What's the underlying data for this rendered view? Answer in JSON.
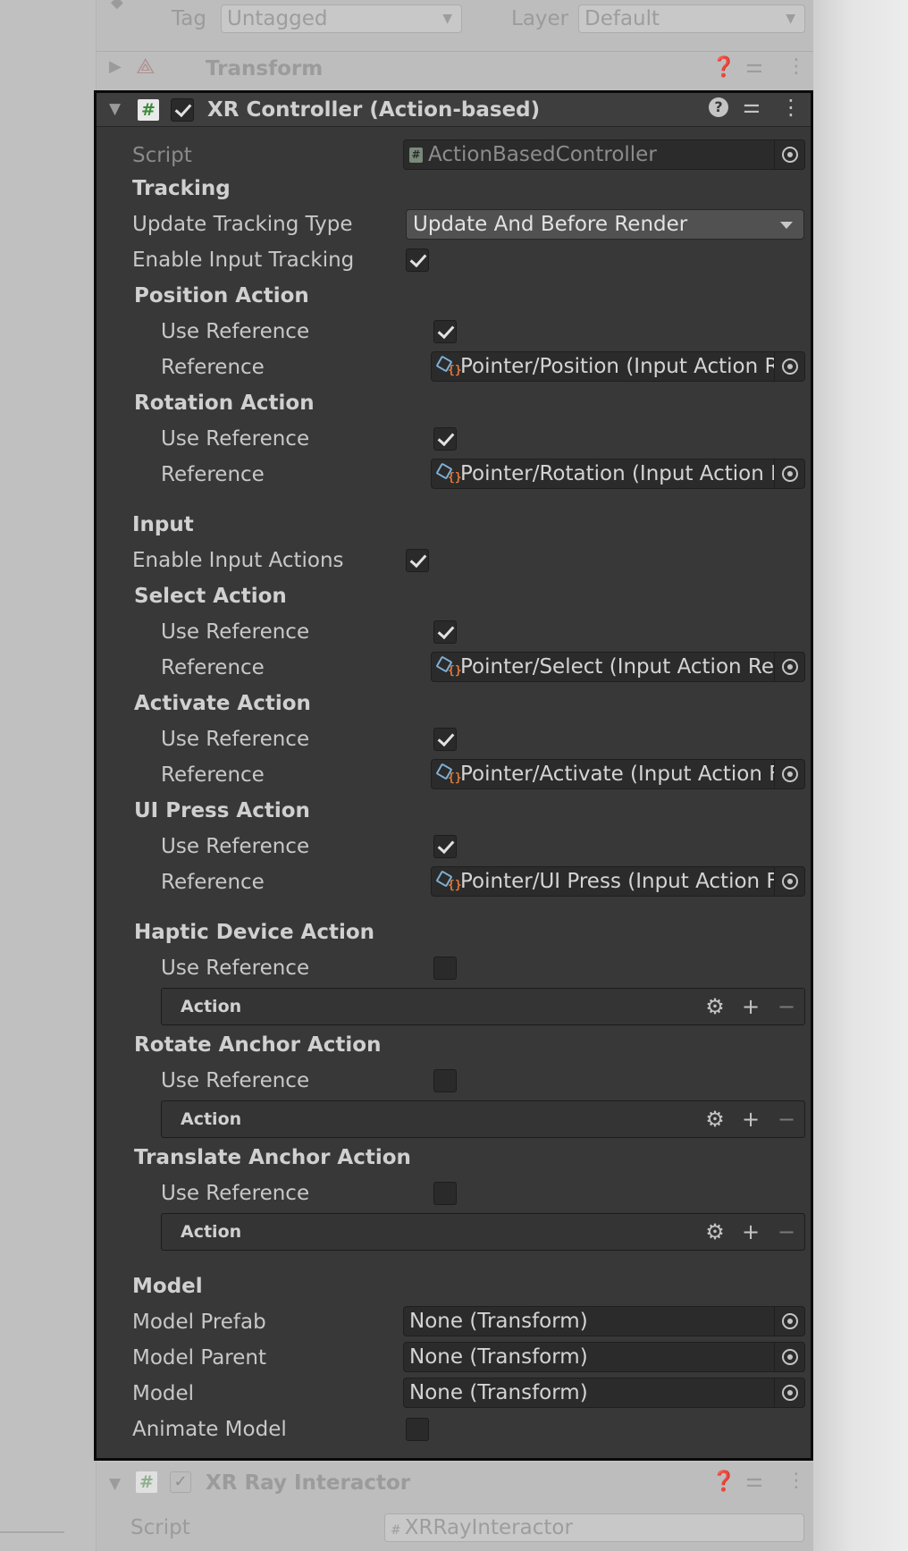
{
  "top_bar": {
    "tag_label": "Tag",
    "tag_value": "Untagged",
    "layer_label": "Layer",
    "layer_value": "Default"
  },
  "transform": {
    "title": "Transform"
  },
  "component": {
    "title": "XR Controller (Action-based)",
    "enabled": true
  },
  "script": {
    "label": "Script",
    "value": "ActionBasedController"
  },
  "tracking": {
    "header": "Tracking",
    "update_type_label": "Update Tracking Type",
    "update_type_value": "Update And Before Render",
    "enable_input_tracking_label": "Enable Input Tracking",
    "enable_input_tracking": true
  },
  "tracking_actions": [
    {
      "header": "Position Action",
      "use_ref_label": "Use Reference",
      "use_ref": true,
      "ref_label": "Reference",
      "ref_value": "Pointer/Position (Input Action R"
    },
    {
      "header": "Rotation Action",
      "use_ref_label": "Use Reference",
      "use_ref": true,
      "ref_label": "Reference",
      "ref_value": "Pointer/Rotation (Input Action F"
    }
  ],
  "input": {
    "header": "Input",
    "enable_label": "Enable Input Actions",
    "enabled": true
  },
  "input_actions": [
    {
      "header": "Select Action",
      "use_ref_label": "Use Reference",
      "use_ref": true,
      "ref_label": "Reference",
      "ref_value": "Pointer/Select (Input Action Re"
    },
    {
      "header": "Activate Action",
      "use_ref_label": "Use Reference",
      "use_ref": true,
      "ref_label": "Reference",
      "ref_value": "Pointer/Activate (Input Action F"
    },
    {
      "header": "UI Press Action",
      "use_ref_label": "Use Reference",
      "use_ref": true,
      "ref_label": "Reference",
      "ref_value": "Pointer/UI Press (Input Action F"
    }
  ],
  "unreferenced_actions": [
    {
      "header": "Haptic Device Action",
      "use_ref_label": "Use Reference",
      "use_ref": false,
      "action_label": "Action"
    },
    {
      "header": "Rotate Anchor Action",
      "use_ref_label": "Use Reference",
      "use_ref": false,
      "action_label": "Action"
    },
    {
      "header": "Translate Anchor Action",
      "use_ref_label": "Use Reference",
      "use_ref": false,
      "action_label": "Action"
    }
  ],
  "model": {
    "header": "Model",
    "prefab_label": "Model Prefab",
    "prefab_value": "None (Transform)",
    "parent_label": "Model Parent",
    "parent_value": "None (Transform)",
    "model_label": "Model",
    "model_value": "None (Transform)",
    "animate_label": "Animate Model",
    "animate": false
  },
  "next_component": {
    "title": "XR Ray Interactor",
    "script_label": "Script",
    "script_value": "XRRayInteractor"
  },
  "icons": {
    "help": "help-icon",
    "presets": "presets-icon",
    "menu": "kebab-menu-icon",
    "settings": "gear-icon",
    "add": "plus-icon",
    "remove": "minus-icon",
    "target": "object-picker-icon"
  },
  "colors": {
    "panel": "#383838",
    "border": "#0a0a0a",
    "script_icon": "#4c9e4c"
  }
}
